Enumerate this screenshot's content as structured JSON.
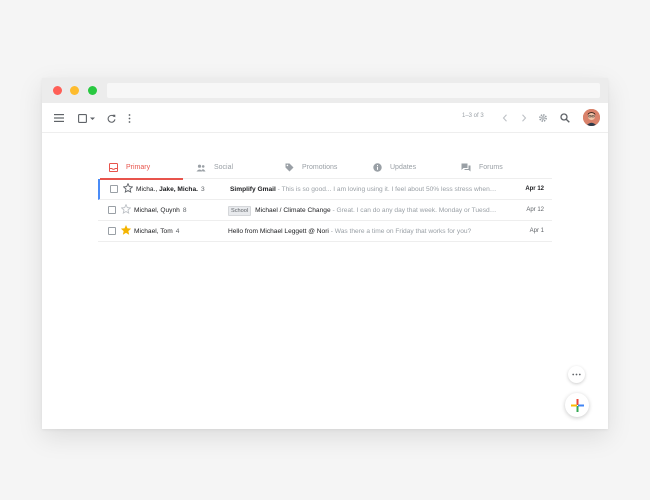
{
  "toolbar": {
    "menu_icon": "hamburger-icon",
    "select_icon": "checkbox-dropdown-icon",
    "refresh_icon": "refresh-icon",
    "more_icon": "more-vert-icon",
    "pager_text": "1–3 of 3",
    "settings_icon": "gear-icon",
    "search_icon": "search-icon"
  },
  "tabs": [
    {
      "label": "Primary",
      "icon": "inbox-icon",
      "active": true
    },
    {
      "label": "Social",
      "icon": "people-icon",
      "active": false
    },
    {
      "label": "Promotions",
      "icon": "tag-icon",
      "active": false
    },
    {
      "label": "Updates",
      "icon": "info-icon",
      "active": false
    },
    {
      "label": "Forums",
      "icon": "forum-icon",
      "active": false
    }
  ],
  "emails": [
    {
      "sender_pre": "Micha., ",
      "sender_bold": "Jake, Micha.",
      "count": "3",
      "label": "",
      "subject": "Simplify Gmail",
      "snippet": "This is so good... I am loving using it. I feel about 50% less stress when…",
      "date": "Apr 12",
      "starred": false,
      "unread": true
    },
    {
      "sender_pre": "Michael, Quynh",
      "sender_bold": "",
      "count": "8",
      "label": "School",
      "subject": "Michael / Climate Change",
      "snippet": "Great. I can do any day that week. Monday or Tuesd…",
      "date": "Apr 12",
      "starred": false,
      "unread": false
    },
    {
      "sender_pre": "Michael, Tom",
      "sender_bold": "",
      "count": "4",
      "label": "",
      "subject": "Hello from Michael Leggett @ Nori",
      "snippet": "Was there a time on Friday that works for you?",
      "date": "Apr 1",
      "starred": true,
      "unread": false
    }
  ],
  "colors": {
    "accent": "#e8544c",
    "star": "#f4b400",
    "unread_marker": "#4a8cf7"
  }
}
